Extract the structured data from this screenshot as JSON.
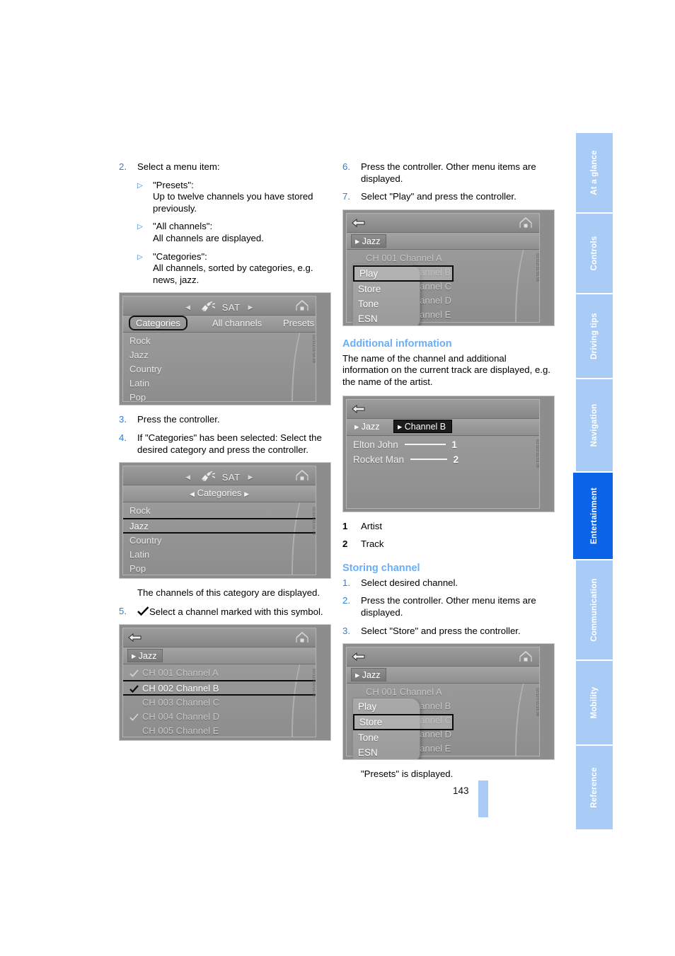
{
  "page": {
    "number": "143",
    "section_tab": "Entertainment"
  },
  "sidebar": {
    "items": [
      {
        "label": "At a glance",
        "active": false
      },
      {
        "label": "Controls",
        "active": false
      },
      {
        "label": "Driving tips",
        "active": false
      },
      {
        "label": "Navigation",
        "active": false
      },
      {
        "label": "Entertainment",
        "active": true
      },
      {
        "label": "Communication",
        "active": false
      },
      {
        "label": "Mobility",
        "active": false
      },
      {
        "label": "Reference",
        "active": false
      }
    ],
    "colors": {
      "inactive": "#a9ccf7",
      "active": "#0b63e8"
    }
  },
  "left_column": {
    "step2": {
      "num": "2.",
      "text": "Select a menu item:"
    },
    "bullets": [
      {
        "title": "\"Presets\":",
        "desc": "Up to twelve channels you have stored previously."
      },
      {
        "title": "\"All channels\":",
        "desc": "All channels are displayed."
      },
      {
        "title": "\"Categories\":",
        "desc": "All channels, sorted by categories, e.g. news, jazz."
      }
    ],
    "step3": {
      "num": "3.",
      "text": "Press the controller."
    },
    "step4": {
      "num": "4.",
      "text": "If \"Categories\" has been selected: Select the desired category and press the controller."
    },
    "after_shot2": "The channels of this category are displayed.",
    "step5": {
      "num": "5.",
      "text": "Select a channel marked with this symbol."
    }
  },
  "right_column": {
    "step6": {
      "num": "6.",
      "text": "Press the controller. Other menu items are displayed."
    },
    "step7": {
      "num": "7.",
      "text": "Select \"Play\" and press the controller."
    },
    "additional_information": {
      "heading": "Additional information",
      "paragraph": "The name of the channel and additional information on the current track are displayed, e.g. the name of the artist.",
      "legend": [
        {
          "num": "1",
          "label": "Artist"
        },
        {
          "num": "2",
          "label": "Track"
        }
      ]
    },
    "storing_channel": {
      "heading": "Storing channel",
      "steps": [
        {
          "num": "1.",
          "text": "Select desired channel."
        },
        {
          "num": "2.",
          "text": "Press the controller. Other menu items are displayed."
        },
        {
          "num": "3.",
          "text": "Select \"Store\" and press the controller."
        }
      ]
    },
    "footer_note": "\"Presets\" is displayed."
  },
  "screens": {
    "categories_tabs": {
      "title": "SAT",
      "tabs": [
        {
          "label": "Categories",
          "selected": true
        },
        {
          "label": "All channels",
          "selected": false
        },
        {
          "label": "Presets",
          "selected": false
        }
      ],
      "list": [
        {
          "label": "Rock",
          "selected": false
        },
        {
          "label": "Jazz",
          "selected": false
        },
        {
          "label": "Country",
          "selected": false
        },
        {
          "label": "Latin",
          "selected": false
        },
        {
          "label": "Pop",
          "selected": false
        }
      ],
      "code": "02/112/11/16.08"
    },
    "categories_selected": {
      "title": "SAT",
      "breadcrumb": "Categories",
      "list": [
        {
          "label": "Rock",
          "selected": false
        },
        {
          "label": "Jazz",
          "selected": true
        },
        {
          "label": "Country",
          "selected": false
        },
        {
          "label": "Latin",
          "selected": false
        },
        {
          "label": "Pop",
          "selected": false
        }
      ],
      "code": "02/118/11/16.08"
    },
    "channel_list": {
      "breadcrumb": "Jazz",
      "list": [
        {
          "label": "CH 001 Channel A",
          "check": true,
          "selected": false
        },
        {
          "label": "CH 002 Channel B",
          "check": true,
          "selected": true
        },
        {
          "label": "CH 003 Channel C",
          "check": false,
          "selected": false
        },
        {
          "label": "CH 004 Channel D",
          "check": true,
          "selected": false
        },
        {
          "label": "CH 005 Channel E",
          "check": false,
          "selected": false
        }
      ],
      "code": "02/120/11/16.08"
    },
    "menu_play": {
      "breadcrumb": "Jazz",
      "background_list": [
        "CH 001 Channel A",
        "hannel B",
        "hannel C",
        "hannel D",
        "hannel E"
      ],
      "menu": [
        {
          "label": "Play",
          "selected": true
        },
        {
          "label": "Store",
          "selected": false
        },
        {
          "label": "Tone",
          "selected": false
        },
        {
          "label": "ESN",
          "selected": false
        }
      ],
      "code": "02/112/11/16.08"
    },
    "now_playing": {
      "breadcrumb_1": "Jazz",
      "breadcrumb_2": "Channel B",
      "artist": "Elton John",
      "track": "Rocket Man",
      "callout_1": "1",
      "callout_2": "2",
      "code": "02/122/11/16.08"
    },
    "menu_store": {
      "breadcrumb": "Jazz",
      "background_list": [
        "CH 001 Channel A",
        "hannel B",
        "hannel C",
        "hannel D",
        "hannel E"
      ],
      "menu": [
        {
          "label": "Play",
          "selected": false
        },
        {
          "label": "Store",
          "selected": true
        },
        {
          "label": "Tone",
          "selected": false
        },
        {
          "label": "ESN",
          "selected": false
        }
      ],
      "code": "02/127/11/16.08"
    }
  }
}
